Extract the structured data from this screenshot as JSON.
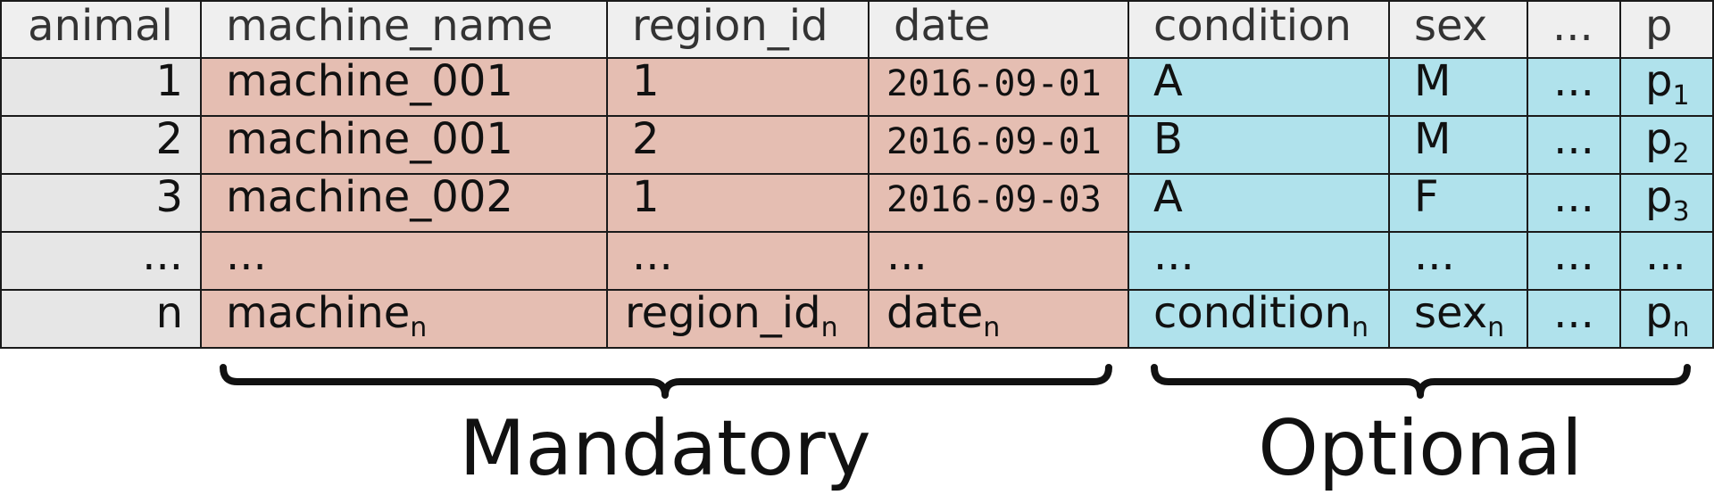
{
  "table": {
    "columns": [
      {
        "header": "animal",
        "group": "index"
      },
      {
        "header": "machine_name",
        "group": "mandatory"
      },
      {
        "header": "region_id",
        "group": "mandatory"
      },
      {
        "header": "date",
        "group": "mandatory"
      },
      {
        "header": "condition",
        "group": "optional"
      },
      {
        "header": "sex",
        "group": "optional"
      },
      {
        "header": "...",
        "group": "optional"
      },
      {
        "header": "p",
        "group": "optional"
      }
    ],
    "rows": [
      [
        {
          "t": "1"
        },
        {
          "t": "machine_001"
        },
        {
          "t": "1"
        },
        {
          "t": "2016-09-01"
        },
        {
          "t": "A"
        },
        {
          "t": "M"
        },
        {
          "t": "..."
        },
        {
          "t": "p",
          "sub": "1"
        }
      ],
      [
        {
          "t": "2"
        },
        {
          "t": "machine_001"
        },
        {
          "t": "2"
        },
        {
          "t": "2016-09-01"
        },
        {
          "t": "B"
        },
        {
          "t": "M"
        },
        {
          "t": "..."
        },
        {
          "t": "p",
          "sub": "2"
        }
      ],
      [
        {
          "t": "3"
        },
        {
          "t": "machine_002"
        },
        {
          "t": "1"
        },
        {
          "t": "2016-09-03"
        },
        {
          "t": "A"
        },
        {
          "t": "F"
        },
        {
          "t": "..."
        },
        {
          "t": "p",
          "sub": "3"
        }
      ],
      [
        {
          "t": "..."
        },
        {
          "t": "..."
        },
        {
          "t": "..."
        },
        {
          "t": "..."
        },
        {
          "t": "..."
        },
        {
          "t": "..."
        },
        {
          "t": "..."
        },
        {
          "t": "..."
        }
      ],
      [
        {
          "t": "n"
        },
        {
          "t": "machine",
          "sub": "n"
        },
        {
          "t": "region_id",
          "sub": "n"
        },
        {
          "t": "date",
          "sub": "n"
        },
        {
          "t": "condition",
          "sub": "n"
        },
        {
          "t": "sex",
          "sub": "n"
        },
        {
          "t": "..."
        },
        {
          "t": "p",
          "sub": "n"
        }
      ]
    ]
  },
  "groups": {
    "mandatory": {
      "label": "Mandatory"
    },
    "optional": {
      "label": "Optional"
    }
  },
  "colors": {
    "index": "#e6e6e6",
    "header": "#efefef",
    "mandatory": "#e5beb2",
    "optional": "#b0e2ec",
    "text": "#111111",
    "header_text": "#333333",
    "grid": "#1a1a1a"
  }
}
